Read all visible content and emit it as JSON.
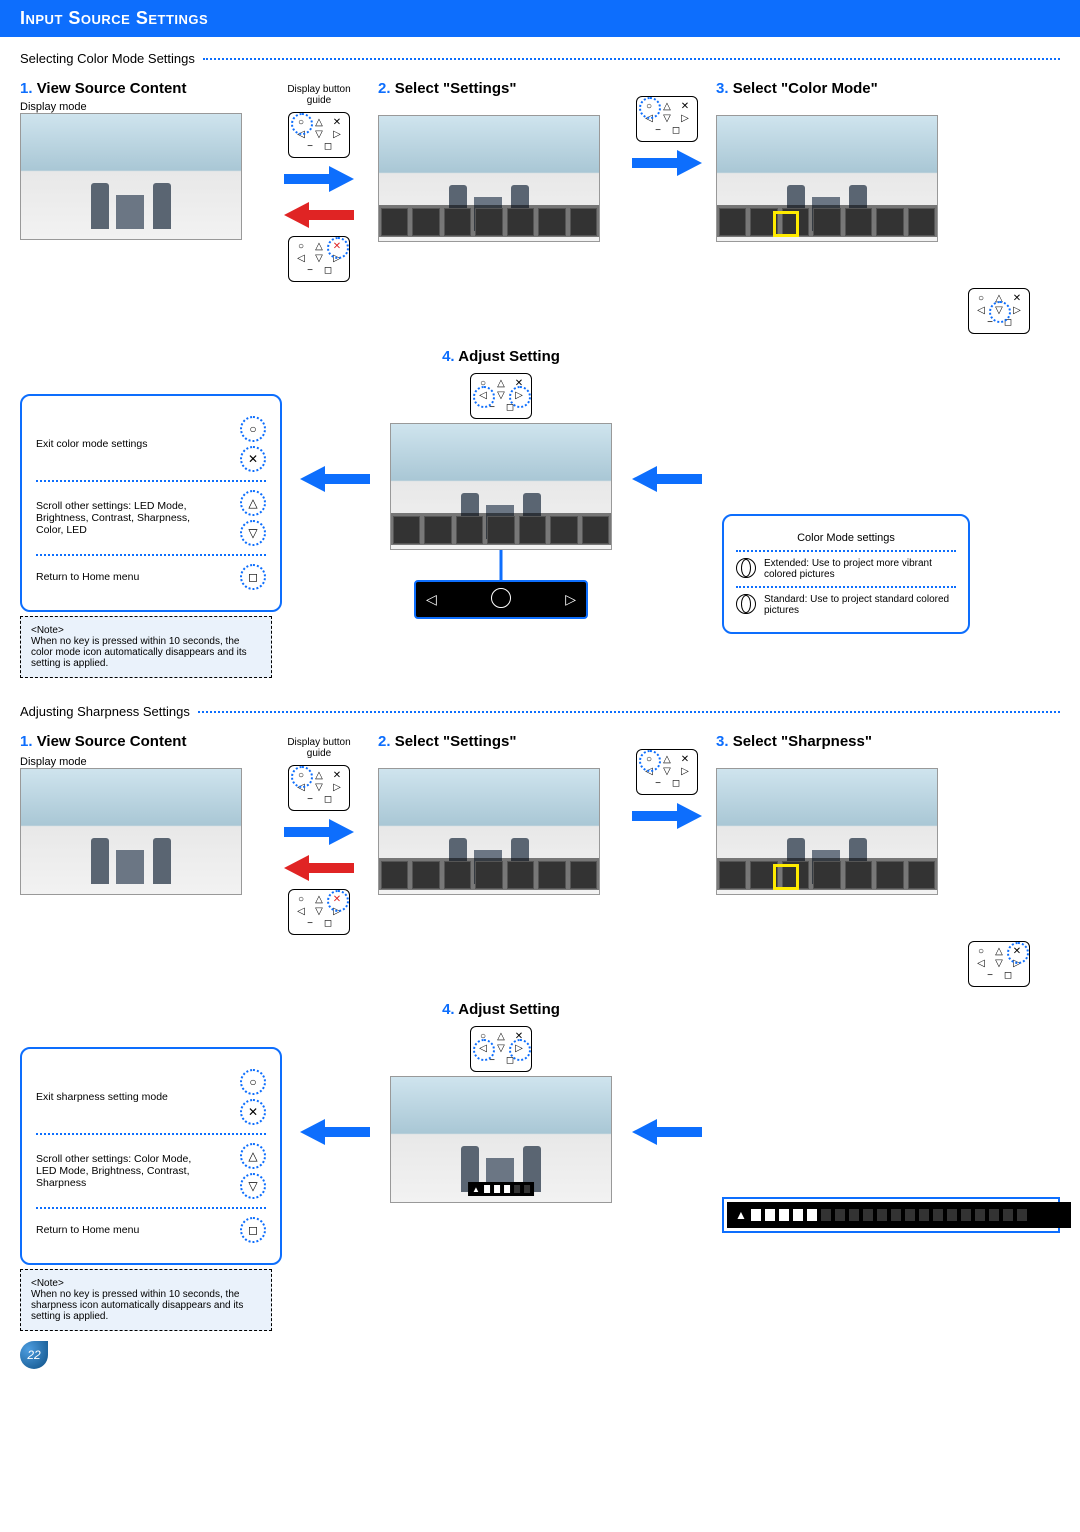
{
  "header": "Input Source Settings",
  "page_number": "22",
  "sections": [
    {
      "title": "Selecting Color Mode Settings",
      "steps": {
        "s1": {
          "num": "1.",
          "label": "View Source Content",
          "sub": "Display mode",
          "guide_label": "Display button guide"
        },
        "s2": {
          "num": "2.",
          "label": "Select \"Settings\""
        },
        "s3": {
          "num": "3.",
          "label": "Select \"Color Mode\""
        },
        "s4": {
          "num": "4.",
          "label": "Adjust Setting"
        }
      },
      "legend": {
        "r1": "Exit color mode settings",
        "r2": "Scroll other settings: LED Mode, Brightness, Contrast, Sharpness, Color, LED",
        "r3": "Return to Home menu"
      },
      "note": {
        "title": "<Note>",
        "body": "When no key is pressed within 10 seconds, the color mode icon automatically disappears and its setting is applied."
      },
      "info": {
        "title": "Color Mode settings",
        "r1": "Extended: Use to project more vibrant colored pictures",
        "r1b": "vibrant colored pictures",
        "r2": "Standard: Use to project standard colored pictures"
      }
    },
    {
      "title": "Adjusting Sharpness Settings",
      "steps": {
        "s1": {
          "num": "1.",
          "label": "View Source Content",
          "sub": "Display mode",
          "guide_label": "Display button guide"
        },
        "s2": {
          "num": "2.",
          "label": "Select \"Settings\""
        },
        "s3": {
          "num": "3.",
          "label": "Select \"Sharpness\""
        },
        "s4": {
          "num": "4.",
          "label": "Adjust Setting"
        }
      },
      "legend": {
        "r1": "Exit sharpness setting mode",
        "r2": "Scroll other settings: Color Mode, LED Mode, Brightness, Contrast, Sharpness",
        "r3": "Return to Home menu"
      },
      "note": {
        "title": "<Note>",
        "body": "When no key is pressed within 10 seconds, the sharpness icon automatically disappears and its setting is applied."
      }
    }
  ]
}
